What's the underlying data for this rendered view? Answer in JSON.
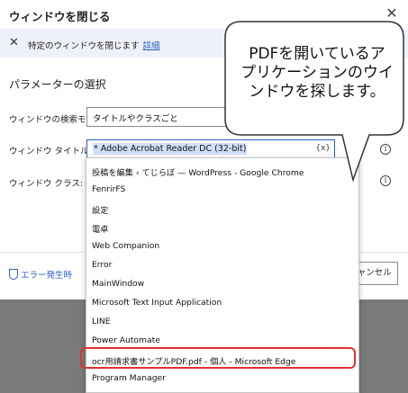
{
  "dialog": {
    "title": "ウィンドウを閉じる",
    "close_glyph": "✕"
  },
  "infobar": {
    "icon_glyph": "✕",
    "text": "特定のウィンドウを閉じます",
    "link": "詳細"
  },
  "params": {
    "section_title": "パラメーターの選択",
    "search_mode_label": "ウィンドウの検索モード:",
    "search_mode_value": "タイトルやクラスごと",
    "title_label": "ウィンドウ タイトル:",
    "title_value": "* Adobe Acrobat Reader DC (32-bit)",
    "var_button": "{x}",
    "class_label": "ウィンドウ クラス:",
    "help_glyph": "i"
  },
  "footer": {
    "error_link": "エラー発生時",
    "cancel_label": "キャンセル"
  },
  "dropdown": {
    "items": [
      "投稿を編集 ‹ てじらぼ — WordPress - Google Chrome",
      "FenrirFS",
      "設定",
      "電卓",
      "Web Companion",
      "Error",
      "MainWindow",
      "Microsoft Text Input Application",
      "LINE",
      "Power Automate",
      "ocr用請求書サンプルPDF.pdf - 個人 - Microsoft Edge",
      "Program Manager"
    ]
  },
  "callout": {
    "lines": [
      "PDFを開いているア",
      "プリケーションのウイ",
      "ンドウを探します。"
    ]
  },
  "colors": {
    "accent": "#2a5fc4",
    "highlight": "#e03131"
  }
}
